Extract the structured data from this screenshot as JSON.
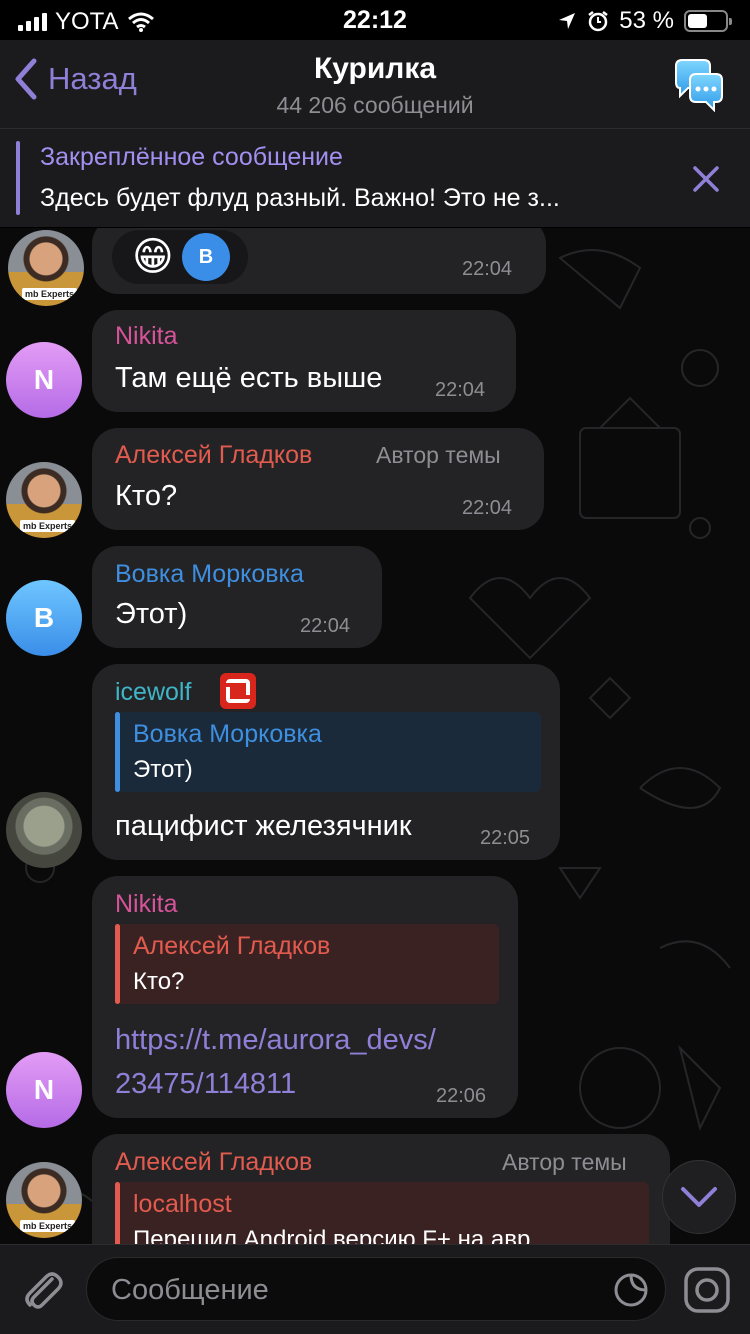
{
  "status_bar": {
    "carrier": "YOTA",
    "time": "22:12",
    "battery": "53 %",
    "battery_level": 0.53
  },
  "header": {
    "back_label": "Назад",
    "title": "Курилка",
    "subtitle": "44 206 сообщений"
  },
  "pinned": {
    "title": "Закреплённое сообщение",
    "text": "Здесь будет флуд разный. Важно! Это не з..."
  },
  "messages": [
    {
      "avatar": "photo",
      "reactions": [
        "😁",
        "B"
      ],
      "time": "22:04"
    },
    {
      "avatar_letter": "N",
      "sender": "Nikita",
      "text": "Там ещё есть выше",
      "time": "22:04"
    },
    {
      "sender": "Алексей Гладков",
      "badge": "Автор темы",
      "text": "Кто?",
      "time": "22:04"
    },
    {
      "avatar_letter": "B",
      "sender": "Вовка Морковка",
      "text": "Этот)",
      "time": "22:04"
    },
    {
      "sender": "icewolf",
      "reply_name": "Вовка Морковка",
      "reply_text": "Этот)",
      "text": "пацифист железячник",
      "time": "22:05"
    },
    {
      "avatar_letter": "N",
      "sender": "Nikita",
      "reply_name": "Алексей Гладков",
      "reply_text": "Кто?",
      "link_line1": "https://t.me/aurora_devs/",
      "link_line2": "23475/114811",
      "time": "22:06"
    },
    {
      "sender": "Алексей Гладков",
      "badge": "Автор темы",
      "reply_name": "localhost",
      "reply_text": "Перешил Android версию F+ на авр"
    }
  ],
  "input": {
    "placeholder": "Сообщение"
  },
  "colors": {
    "accent": "#8f7fd6",
    "bubble": "#232325",
    "red_name": "#e35b4f",
    "pink_name": "#d7539a",
    "blue_name": "#3f8fe0",
    "teal_name": "#3fb6c8"
  }
}
